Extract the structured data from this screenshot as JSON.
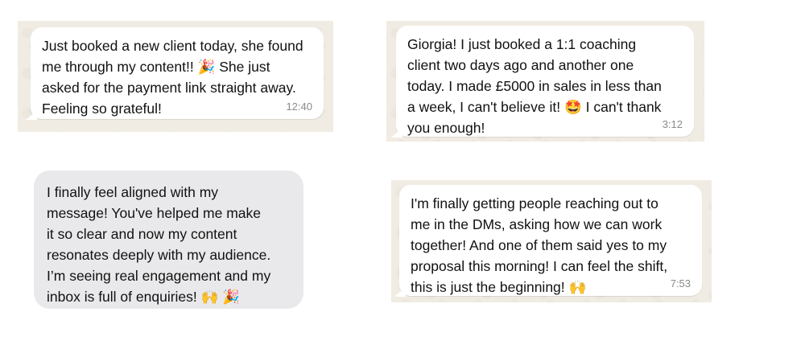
{
  "messages": [
    {
      "text": "Just booked a new client today, she found\nme through my content!! 🎉 She just\nasked for the payment link straight away.\nFeeling so grateful!",
      "time": "12:40"
    },
    {
      "text": "Giorgia! I just booked a 1:1 coaching\nclient two days ago and another one\ntoday. I made £5000 in sales in less than\na week, I can't believe it! 🤩 I can't thank\nyou enough!",
      "time": "3:12"
    },
    {
      "text": "I finally feel aligned with my\nmessage! You've helped me make\nit so clear and now my content\nresonates deeply with my audience.\nI’m seeing real engagement and my\ninbox is full of enquiries! 🙌 🎉"
    },
    {
      "text": "I'm finally getting people reaching out to\nme in the DMs, asking how we can work\ntogether! And one of them said yes to my\nproposal this morning! I can feel the shift,\nthis is just the beginning! 🙌",
      "time": "7:53"
    }
  ],
  "colors": {
    "chat_background": "#f1ece3",
    "bubble": "#ffffff",
    "imessage_bubble": "#e9e9eb",
    "timestamp": "#8a8a8a"
  }
}
